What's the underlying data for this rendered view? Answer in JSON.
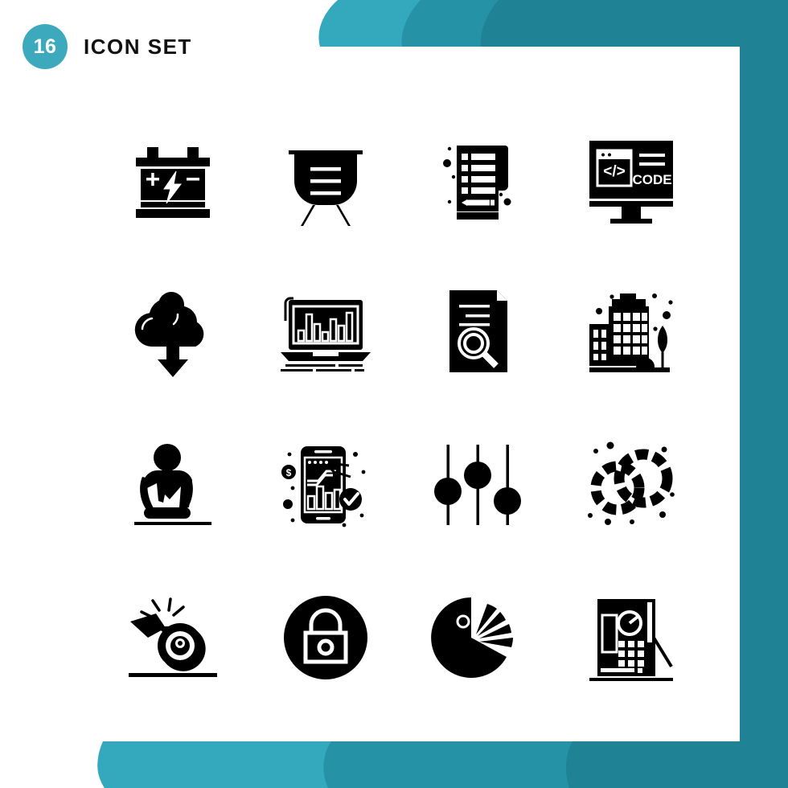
{
  "header": {
    "count": "16",
    "title": "Icon Set",
    "badge_color": "#3da9bd",
    "title_color": "#111111"
  },
  "theme": {
    "background": "#ffffff",
    "teal_light": "#34a8bc",
    "teal_mid": "#2592a6",
    "teal_dark": "#1f8295",
    "icon_color": "#000000"
  },
  "grid": {
    "columns": 4,
    "rows": 4,
    "total": 16
  },
  "icons": [
    {
      "index": 1,
      "name": "car-battery-icon",
      "label": "Car Battery",
      "row": 1,
      "col": 1
    },
    {
      "index": 2,
      "name": "presentation-board-icon",
      "label": "Presentation Board",
      "row": 1,
      "col": 2
    },
    {
      "index": 3,
      "name": "checklist-notepad-icon",
      "label": "Checklist Notepad",
      "row": 1,
      "col": 3
    },
    {
      "index": 4,
      "name": "code-monitor-icon",
      "label": "Code Monitor",
      "row": 1,
      "col": 4,
      "screen_text": "CODE",
      "code_glyph": "</>"
    },
    {
      "index": 5,
      "name": "cloud-download-icon",
      "label": "Cloud Download",
      "row": 2,
      "col": 1
    },
    {
      "index": 6,
      "name": "laptop-bar-chart-icon",
      "label": "Laptop Bar Chart",
      "row": 2,
      "col": 2
    },
    {
      "index": 7,
      "name": "document-search-icon",
      "label": "Document Search",
      "row": 2,
      "col": 3
    },
    {
      "index": 8,
      "name": "office-buildings-icon",
      "label": "Office Buildings",
      "row": 2,
      "col": 4
    },
    {
      "index": 9,
      "name": "cpr-resuscitation-icon",
      "label": "CPR Resuscitation",
      "row": 3,
      "col": 1
    },
    {
      "index": 10,
      "name": "mobile-analytics-icon",
      "label": "Mobile Analytics",
      "row": 3,
      "col": 2
    },
    {
      "index": 11,
      "name": "settings-sliders-icon",
      "label": "Settings Sliders",
      "row": 3,
      "col": 3
    },
    {
      "index": 12,
      "name": "linked-rings-icon",
      "label": "Linked Rings",
      "row": 3,
      "col": 4
    },
    {
      "index": 13,
      "name": "whistle-icon",
      "label": "Whistle",
      "row": 4,
      "col": 1
    },
    {
      "index": 14,
      "name": "padlock-circle-icon",
      "label": "Padlock",
      "row": 4,
      "col": 2
    },
    {
      "index": 15,
      "name": "pie-chart-icon",
      "label": "Pie Chart",
      "row": 4,
      "col": 3
    },
    {
      "index": 16,
      "name": "safe-vault-icon",
      "label": "Safe Vault",
      "row": 4,
      "col": 4
    }
  ]
}
